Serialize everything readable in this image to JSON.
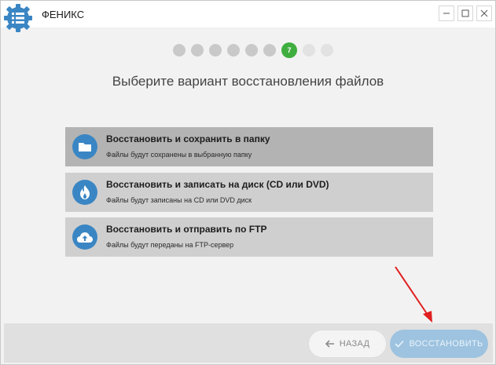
{
  "app": {
    "title": "ФЕНИКС"
  },
  "window_controls": {
    "minimize_icon": "minimize-icon",
    "maximize_icon": "maximize-icon",
    "close_icon": "close-icon"
  },
  "steps": {
    "total": 9,
    "current": 7,
    "current_label": "7"
  },
  "heading": "Выберите вариант восстановления файлов",
  "options": [
    {
      "title": "Восстановить и сохранить в папку",
      "description": "Файлы будут сохранены в выбранную папку",
      "icon": "folder-icon",
      "selected": true
    },
    {
      "title": "Восстановить и записать на диск (CD или DVD)",
      "description": "Файлы будут записаны на CD или DVD диск",
      "icon": "flame-icon",
      "selected": false
    },
    {
      "title": "Восстановить и отправить по FTP",
      "description": "Файлы будут переданы на FTP-сервер",
      "icon": "cloud-upload-icon",
      "selected": false
    }
  ],
  "footer": {
    "back_label": "НАЗАД",
    "restore_label": "ВОССТАНОВИТЬ"
  },
  "colors": {
    "accent_blue": "#3a86c4",
    "step_active": "#3fae3f",
    "annotation_arrow": "#e02020"
  }
}
